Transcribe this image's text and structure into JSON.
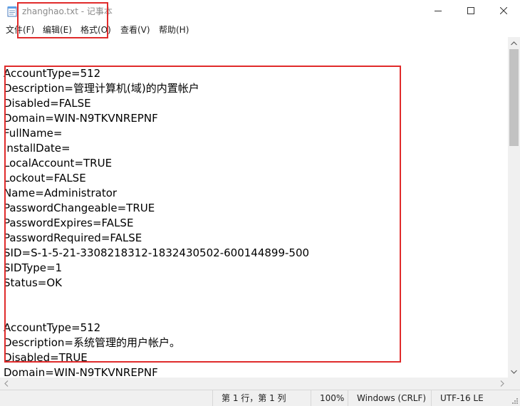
{
  "window": {
    "title": "zhanghao.txt - 记事本"
  },
  "icons": {
    "app": "notepad-icon",
    "minimize": "minimize-icon",
    "maximize": "maximize-icon",
    "close": "close-icon"
  },
  "menu": {
    "file": "文件(F)",
    "edit": "编辑(E)",
    "format": "格式(O)",
    "view": "查看(V)",
    "help": "帮助(H)"
  },
  "content": {
    "lines": [
      "",
      "",
      "AccountType=512",
      "Description=管理计算机(域)的内置帐户",
      "Disabled=FALSE",
      "Domain=WIN-N9TKVNREPNF",
      "FullName=",
      "InstallDate=",
      "LocalAccount=TRUE",
      "Lockout=FALSE",
      "Name=Administrator",
      "PasswordChangeable=TRUE",
      "PasswordExpires=FALSE",
      "PasswordRequired=FALSE",
      "SID=S-1-5-21-3308218312-1832430502-600144899-500",
      "SIDType=1",
      "Status=OK",
      "",
      "",
      "AccountType=512",
      "Description=系统管理的用户帐户。",
      "Disabled=TRUE",
      "Domain=WIN-N9TKVNREPNF"
    ]
  },
  "status": {
    "position": "第 1 行，第 1 列",
    "zoom": "100%",
    "line_ending": "Windows (CRLF)",
    "encoding": "UTF-16 LE"
  },
  "colors": {
    "highlight": "#e02b2b",
    "chrome": "#f0f0f0"
  }
}
